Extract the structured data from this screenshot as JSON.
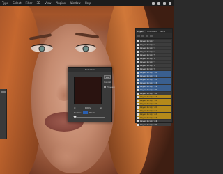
{
  "menubar": {
    "items": [
      "Type",
      "Select",
      "Filter",
      "3D",
      "View",
      "Plugins",
      "Window",
      "Help"
    ]
  },
  "layers_panel": {
    "tabs": [
      "Layers",
      "Channels",
      "Paths"
    ],
    "rows": [
      {
        "label": "Layer 1 copy",
        "color": "none"
      },
      {
        "label": "Layer 1 copy 2",
        "color": "none"
      },
      {
        "label": "Layer 1 copy 3",
        "color": "none"
      },
      {
        "label": "Layer 1 copy 4",
        "color": "none"
      },
      {
        "label": "Layer 1 copy 5",
        "color": "none"
      },
      {
        "label": "Layer 1 copy 6",
        "color": "none"
      },
      {
        "label": "Layer 1 copy 7",
        "color": "none"
      },
      {
        "label": "Layer 1 copy 8",
        "color": "none"
      },
      {
        "label": "Layer 1 copy 9",
        "color": "none"
      },
      {
        "label": "Layer 1 copy 10",
        "color": "blue"
      },
      {
        "label": "Layer 1 copy 11",
        "color": "blue"
      },
      {
        "label": "Layer 1 copy 12",
        "color": "blue"
      },
      {
        "label": "Layer 1 copy 13",
        "color": "blue"
      },
      {
        "label": "Layer 1 copy 14",
        "color": "blue"
      },
      {
        "label": "Layer 1 copy 15",
        "color": "blue"
      },
      {
        "label": "Layer 1 copy 16",
        "color": "none"
      },
      {
        "label": "Layer 1 copy 17",
        "color": "yellow"
      },
      {
        "label": "Layer 1 copy 18",
        "color": "yellow"
      },
      {
        "label": "Layer 1 copy 19",
        "color": "yellow"
      },
      {
        "label": "Layer 1 copy 20",
        "color": "yellow"
      },
      {
        "label": "Layer 1 copy 21",
        "color": "yellow"
      },
      {
        "label": "Layer 1 copy 22",
        "color": "yellow"
      },
      {
        "label": "Layer 1 copy 23",
        "color": "yellow"
      },
      {
        "label": "Layer 1 copy 24",
        "color": "none"
      },
      {
        "label": "Layer 1 copy 25",
        "color": "none"
      }
    ]
  },
  "dialog": {
    "title": "Selection",
    "ok_label": "OK",
    "cancel_label": "Cancel",
    "preview_label": "Preview",
    "zoom_value": "100%",
    "radius_label": "Radius:",
    "radius_unit": "Pixels"
  },
  "colors": {
    "layer_blue": "#3a5f8f",
    "layer_yellow": "#b58a1a",
    "ui_dark": "#2b2b2b"
  }
}
